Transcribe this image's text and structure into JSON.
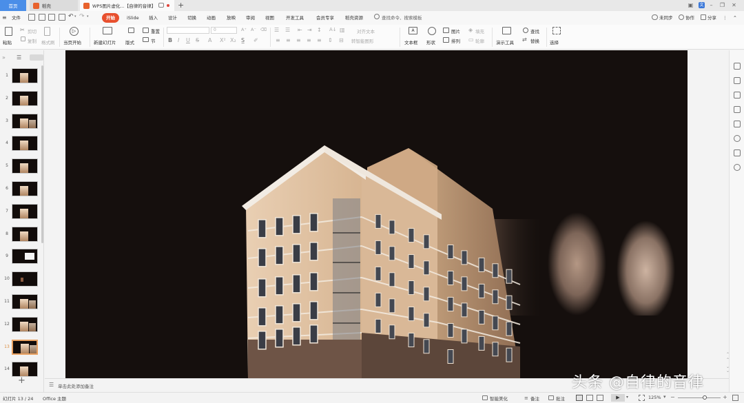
{
  "titlebar": {
    "home_tab": "首页",
    "daoke_tab": "稻壳",
    "doc_tab": "WPS图片虚化...【自律的音律】",
    "new_tab": "+"
  },
  "menubar": {
    "file": "文件",
    "items": [
      "开始",
      "iSlide",
      "插入",
      "设计",
      "切换",
      "动画",
      "放映",
      "审阅",
      "视图",
      "开发工具",
      "会员专享",
      "稻壳资源"
    ],
    "search_placeholder": "查找命令、搜索模板",
    "right": {
      "sync": "未同步",
      "collab": "协作",
      "share": "分享"
    }
  },
  "ribbon": {
    "paste": "粘贴",
    "cut": "剪切",
    "copy": "复制",
    "format_painter": "格式刷",
    "play_from_current": "当页开始",
    "new_slide": "新建幻灯片",
    "layout": "版式",
    "section": "节",
    "reset": "重置",
    "font_size": "0",
    "text_box": "文本框",
    "shape": "形状",
    "picture": "图片",
    "arrange": "排列",
    "fill": "填充",
    "outline": "轮廓",
    "align_text": "对齐文本",
    "convert_smartart": "转智能图形",
    "presentation_tools": "演示工具",
    "find": "查找",
    "replace": "替换",
    "select": "选择"
  },
  "slides": {
    "numbers": [
      "1",
      "2",
      "3",
      "4",
      "5",
      "6",
      "7",
      "8",
      "9",
      "10",
      "11",
      "12",
      "13",
      "14"
    ],
    "active": "13",
    "add": "+"
  },
  "notes": {
    "placeholder": "单击此处添加备注"
  },
  "statusbar": {
    "slide_indicator": "幻灯片 13 / 24",
    "theme": "Office 主题",
    "smart_beautify": "智能美化",
    "notes": "备注",
    "comments": "批注",
    "zoom": "125%"
  },
  "watermark": "头条 @自律的音律",
  "colors": {
    "home_tab": "#4a8ee8",
    "start_pill": "#e8502e",
    "slide_bg": "#150f0d",
    "doc_badge": "#e8622c",
    "daoke_badge": "#e8622c"
  }
}
